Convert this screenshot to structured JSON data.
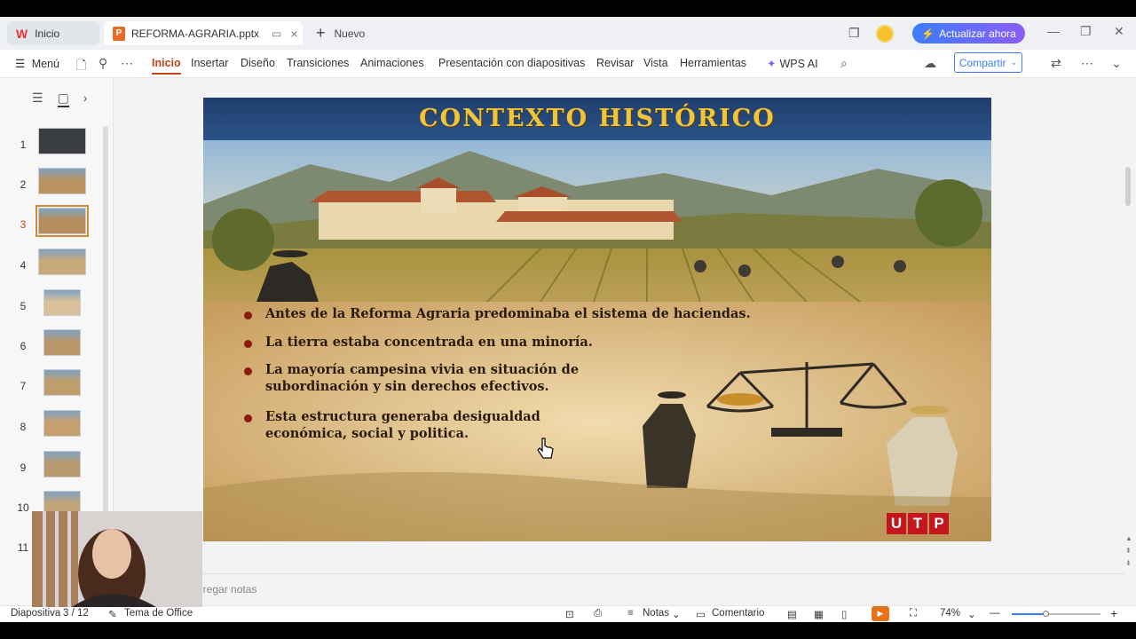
{
  "titlebar": {
    "home_tab": "Inicio",
    "file_tab": "REFORMA-AGRARIA.pptx",
    "new_tab": "Nuevo",
    "update_button": "Actualizar ahora"
  },
  "menubar": {
    "menu_label": "Menú",
    "items": [
      "Inicio",
      "Insertar",
      "Diseño",
      "Transiciones",
      "Animaciones",
      "Presentación con diapositivas",
      "Revisar",
      "Vista",
      "Herramientas"
    ],
    "wps_ai": "WPS AI",
    "share_button": "Compartir"
  },
  "thumbnails": [
    "1",
    "2",
    "3",
    "4",
    "5",
    "6",
    "7",
    "8",
    "9",
    "10",
    "11"
  ],
  "current_slide_index": 3,
  "slide": {
    "title": "CONTEXTO HISTÓRICO",
    "bullets": [
      "Antes de la Reforma Agraria predominaba el sistema de haciendas.",
      "La tierra estaba concentrada en una minoría.",
      "La mayoría campesina vivia en situación de",
      "subordinación y sin derechos efectivos.",
      "Esta estructura generaba desigualdad",
      "económica, social y politica."
    ],
    "logo_letters": [
      "U",
      "T",
      "P"
    ]
  },
  "notes": {
    "placeholder": "gregar notas"
  },
  "statusbar": {
    "slide_label": "Diapositiva",
    "slide_count": "3 / 12",
    "theme": "Tema de Office",
    "notes": "Notas",
    "comment": "Comentario",
    "zoom": "74%",
    "zoom_fraction": 0.38
  },
  "colors": {
    "accent_orange": "#c2461a",
    "update_gradient_start": "#3b7dfc",
    "title_gold": "#f0c53a",
    "utp_red": "#c4161c"
  }
}
